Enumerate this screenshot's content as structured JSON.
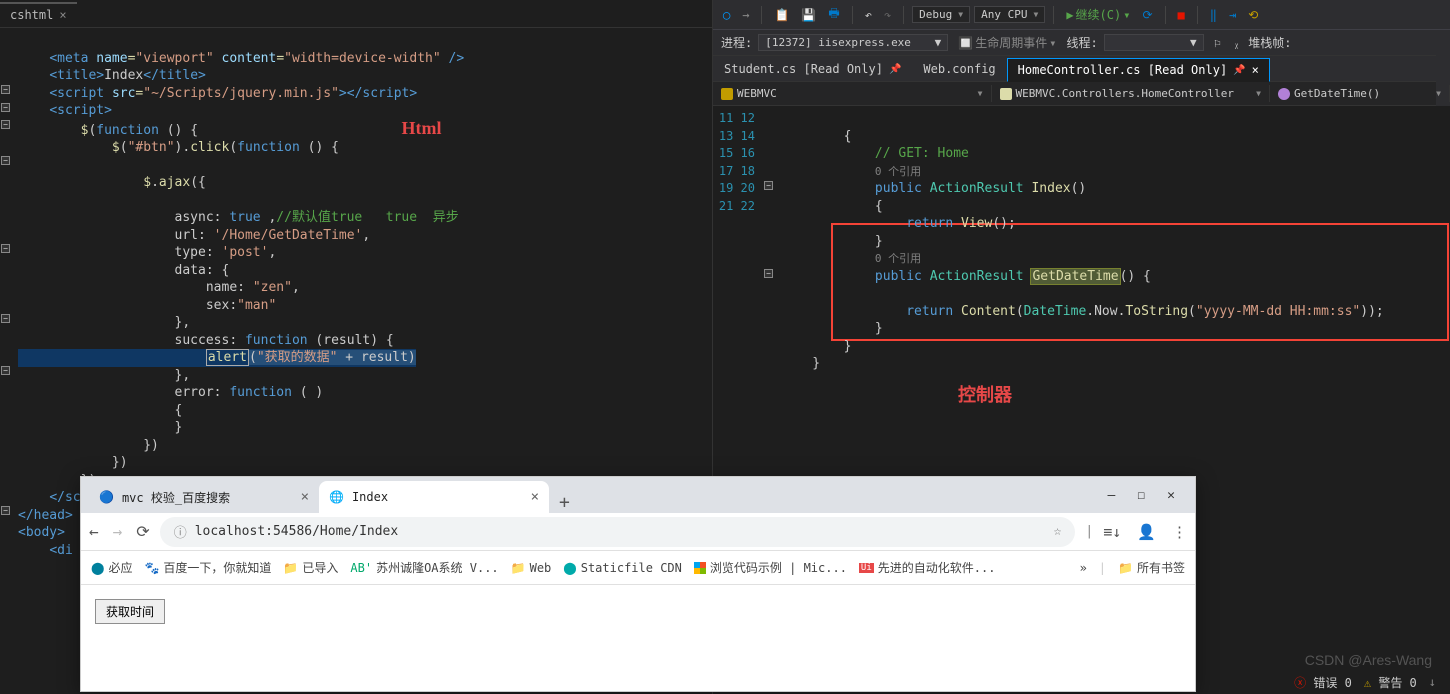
{
  "leftTab": {
    "name": "cshtml",
    "close": "×"
  },
  "leftAnnotation": "Html",
  "leftLines": [
    "    <meta name=\"viewport\" content=\"width=device-width\" />",
    "    <title>Index</title>",
    "    <script src=\"~/Scripts/jquery.min.js\"></script>",
    "    <script>",
    "        $(function () {",
    "            $(\"#btn\").click(function () {",
    "",
    "                $.ajax({",
    "",
    "                    async: true ,//默认值true   true  异步",
    "                    url: '/Home/GetDateTime',",
    "                    type: 'post',",
    "                    data: {",
    "                        name: \"zen\",",
    "                        sex:\"man\"",
    "                    },",
    "                    success: function (result) {",
    "                        alert(\"获取的数据\" + result)",
    "                    },",
    "                    error: function ( )",
    "                    {",
    "                    }",
    "                })",
    "            })",
    "        })",
    "    </script>",
    "</head>",
    "<body>",
    "    <di"
  ],
  "toolbar": {
    "continue": "继续(C)",
    "configs": [
      "Debug",
      "Any CPU"
    ],
    "icons": [
      "◉",
      "↔",
      "|",
      "📋",
      "💾",
      "🖶",
      "|",
      "↶",
      "↷"
    ]
  },
  "processRow": {
    "label": "进程:",
    "value": "[12372] iisexpress.exe",
    "life": "生命周期事件",
    "thread": "线程:",
    "stack": "堆栈帧:"
  },
  "docTabs": [
    {
      "label": "Student.cs [Read Only]",
      "pin": true,
      "active": false
    },
    {
      "label": "Web.config",
      "pin": false,
      "active": false
    },
    {
      "label": "HomeController.cs [Read Only]",
      "pin": true,
      "active": true,
      "close": "×"
    }
  ],
  "nav": {
    "asm": "WEBMVC",
    "cls": "WEBMVC.Controllers.HomeController",
    "mth": "GetDateTime()"
  },
  "lineNums": [
    11,
    12,
    "",
    "",
    13,
    14,
    15,
    16,
    "",
    17,
    18,
    19,
    20,
    21,
    22
  ],
  "rightAnnotation": "控制器",
  "rightRefText": "0 个引用",
  "rightGetComment": "// GET: Home",
  "rightIndex": {
    "pub": "public",
    "ar": "ActionResult",
    "idx": "Index",
    "ret": "return",
    "view": "View"
  },
  "rightGet": {
    "pub": "public",
    "ar": "ActionResult",
    "gdt": "GetDateTime",
    "ret": "return",
    "cnt": "Content",
    "dt": "DateTime",
    "now": "Now",
    "ts": "ToString",
    "fmt": "\"yyyy-MM-dd HH:mm:ss\""
  },
  "browser": {
    "tab1": "mvc 校验_百度搜索",
    "tab2": "Index",
    "url": "localhost:54586/Home/Index",
    "bookmarks": [
      "必应",
      "百度一下，你就知道",
      "已导入",
      "苏州诚隆OA系统 V...",
      "Web",
      "Staticfile CDN",
      "浏览代码示例 | Mic...",
      "先进的自动化软件..."
    ],
    "allBm": "所有书签",
    "btn": "获取时间"
  },
  "status": {
    "err": "错误  0",
    "warn": "警告  0"
  },
  "watermark": "CSDN @Ares-Wang"
}
